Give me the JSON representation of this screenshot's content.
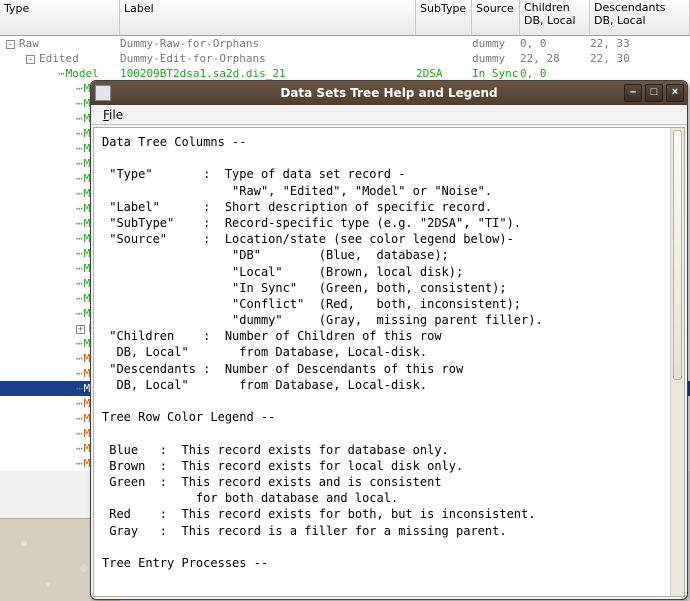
{
  "headers": {
    "type": "Type",
    "label": "Label",
    "subtype": "SubType",
    "source": "Source",
    "children": "Children\nDB, Local",
    "descendants": "Descendants\nDB, Local"
  },
  "rows": [
    {
      "indent": 0,
      "exp": "-",
      "cls": "txt-gray",
      "type": "Raw",
      "label": "Dummy-Raw-for-Orphans",
      "sub": "",
      "source": "dummy",
      "children": "0, 0",
      "desc": "22, 33"
    },
    {
      "indent": 1,
      "exp": "-",
      "cls": "txt-gray",
      "type": "Edited",
      "label": "Dummy-Edit-for-Orphans",
      "sub": "",
      "source": "dummy",
      "children": "22, 28",
      "desc": "22, 30"
    },
    {
      "indent": 2,
      "exp": "",
      "cls": "txt-green",
      "type": "Model",
      "label": "100209BT2dsa1.sa2d.dis_21",
      "sub": "2DSA",
      "source": "In Sync",
      "children": "0, 0",
      "desc": ""
    },
    {
      "indent": 3,
      "exp": "",
      "cls": "txt-green",
      "type": "Mod",
      "label": "",
      "sub": "",
      "source": "",
      "children": "",
      "desc": ""
    },
    {
      "indent": 3,
      "exp": "",
      "cls": "txt-green",
      "type": "Mod",
      "label": "",
      "sub": "",
      "source": "",
      "children": "",
      "desc": ""
    },
    {
      "indent": 3,
      "exp": "",
      "cls": "txt-green",
      "type": "Mod",
      "label": "",
      "sub": "",
      "source": "",
      "children": "",
      "desc": ""
    },
    {
      "indent": 3,
      "exp": "",
      "cls": "txt-green",
      "type": "Mod",
      "label": "",
      "sub": "",
      "source": "",
      "children": "",
      "desc": ""
    },
    {
      "indent": 3,
      "exp": "",
      "cls": "txt-green",
      "type": "Mod",
      "label": "",
      "sub": "",
      "source": "",
      "children": "",
      "desc": ""
    },
    {
      "indent": 3,
      "exp": "",
      "cls": "txt-green",
      "type": "Mod",
      "label": "",
      "sub": "",
      "source": "",
      "children": "",
      "desc": ""
    },
    {
      "indent": 3,
      "exp": "",
      "cls": "txt-green",
      "type": "Mod",
      "label": "",
      "sub": "",
      "source": "",
      "children": "",
      "desc": ""
    },
    {
      "indent": 3,
      "exp": "",
      "cls": "txt-green",
      "type": "Mod",
      "label": "",
      "sub": "",
      "source": "",
      "children": "",
      "desc": ""
    },
    {
      "indent": 3,
      "exp": "",
      "cls": "txt-green",
      "type": "Mod",
      "label": "",
      "sub": "",
      "source": "",
      "children": "",
      "desc": ""
    },
    {
      "indent": 3,
      "exp": "",
      "cls": "txt-green",
      "type": "Mod",
      "label": "",
      "sub": "",
      "source": "",
      "children": "",
      "desc": ""
    },
    {
      "indent": 3,
      "exp": "",
      "cls": "txt-green",
      "type": "Mod",
      "label": "",
      "sub": "",
      "source": "",
      "children": "",
      "desc": ""
    },
    {
      "indent": 3,
      "exp": "",
      "cls": "txt-green",
      "type": "Mod",
      "label": "",
      "sub": "",
      "source": "",
      "children": "",
      "desc": ""
    },
    {
      "indent": 3,
      "exp": "",
      "cls": "txt-green",
      "type": "Mod",
      "label": "",
      "sub": "",
      "source": "",
      "children": "",
      "desc": ""
    },
    {
      "indent": 3,
      "exp": "",
      "cls": "txt-green",
      "type": "Mod",
      "label": "",
      "sub": "",
      "source": "",
      "children": "",
      "desc": ""
    },
    {
      "indent": 3,
      "exp": "",
      "cls": "txt-green",
      "type": "Mod",
      "label": "",
      "sub": "",
      "source": "",
      "children": "",
      "desc": ""
    },
    {
      "indent": 3,
      "exp": "",
      "cls": "txt-green",
      "type": "Mod",
      "label": "",
      "sub": "",
      "source": "",
      "children": "",
      "desc": ""
    },
    {
      "indent": 3,
      "exp": "+",
      "cls": "txt-green",
      "type": "Mod",
      "label": "",
      "sub": "",
      "source": "",
      "children": "",
      "desc": ""
    },
    {
      "indent": 3,
      "exp": "",
      "cls": "txt-green",
      "type": "Mod",
      "label": "",
      "sub": "",
      "source": "",
      "children": "",
      "desc": ""
    },
    {
      "indent": 3,
      "exp": "",
      "cls": "txt-brown",
      "type": "Mod",
      "label": "",
      "sub": "",
      "source": "",
      "children": "",
      "desc": ""
    },
    {
      "indent": 3,
      "exp": "",
      "cls": "txt-brown",
      "type": "Mod",
      "label": "",
      "sub": "",
      "source": "",
      "children": "",
      "desc": ""
    },
    {
      "indent": 3,
      "exp": "",
      "cls": "txt-brown",
      "type": "Mod",
      "label": "",
      "sub": "",
      "source": "",
      "children": "",
      "desc": "",
      "selected": true
    },
    {
      "indent": 3,
      "exp": "",
      "cls": "txt-brown",
      "type": "Mod",
      "label": "",
      "sub": "",
      "source": "",
      "children": "",
      "desc": ""
    },
    {
      "indent": 3,
      "exp": "",
      "cls": "txt-brown",
      "type": "Mod",
      "label": "",
      "sub": "",
      "source": "",
      "children": "",
      "desc": ""
    },
    {
      "indent": 3,
      "exp": "",
      "cls": "txt-brown",
      "type": "Mod",
      "label": "",
      "sub": "",
      "source": "",
      "children": "",
      "desc": ""
    },
    {
      "indent": 3,
      "exp": "",
      "cls": "txt-brown",
      "type": "Mod",
      "label": "",
      "sub": "",
      "source": "",
      "children": "",
      "desc": ""
    },
    {
      "indent": 3,
      "exp": "",
      "cls": "txt-brown",
      "type": "Mod",
      "label": "",
      "sub": "",
      "source": "",
      "children": "",
      "desc": ""
    }
  ],
  "dialog": {
    "title": "Data Sets Tree Help and Legend",
    "menu_file": "File",
    "controls": {
      "min": "–",
      "max": "□",
      "close": "×"
    },
    "body": "Data Tree Columns --\n\n \"Type\"       :  Type of data set record -\n                  \"Raw\", \"Edited\", \"Model\" or \"Noise\".\n \"Label\"      :  Short description of specific record.\n \"SubType\"    :  Record-specific type (e.g. \"2DSA\", \"TI\").\n \"Source\"     :  Location/state (see color legend below)-\n                  \"DB\"        (Blue,  database);\n                  \"Local\"     (Brown, local disk);\n                  \"In Sync\"   (Green, both, consistent);\n                  \"Conflict\"  (Red,   both, inconsistent);\n                  \"dummy\"     (Gray,  missing parent filler).\n \"Children    :  Number of Children of this row\n  DB, Local\"       from Database, Local-disk.\n \"Descendants :  Number of Descendants of this row\n  DB, Local\"       from Database, Local-disk.\n\nTree Row Color Legend --\n\n Blue   :  This record exists for database only.\n Brown  :  This record exists for local disk only.\n Green  :  This record exists and is consistent\n             for both database and local.\n Red    :  This record exists for both, but is inconsistent.\n Gray   :  This record is a filler for a missing parent.\n\nTree Entry Processes --"
  }
}
